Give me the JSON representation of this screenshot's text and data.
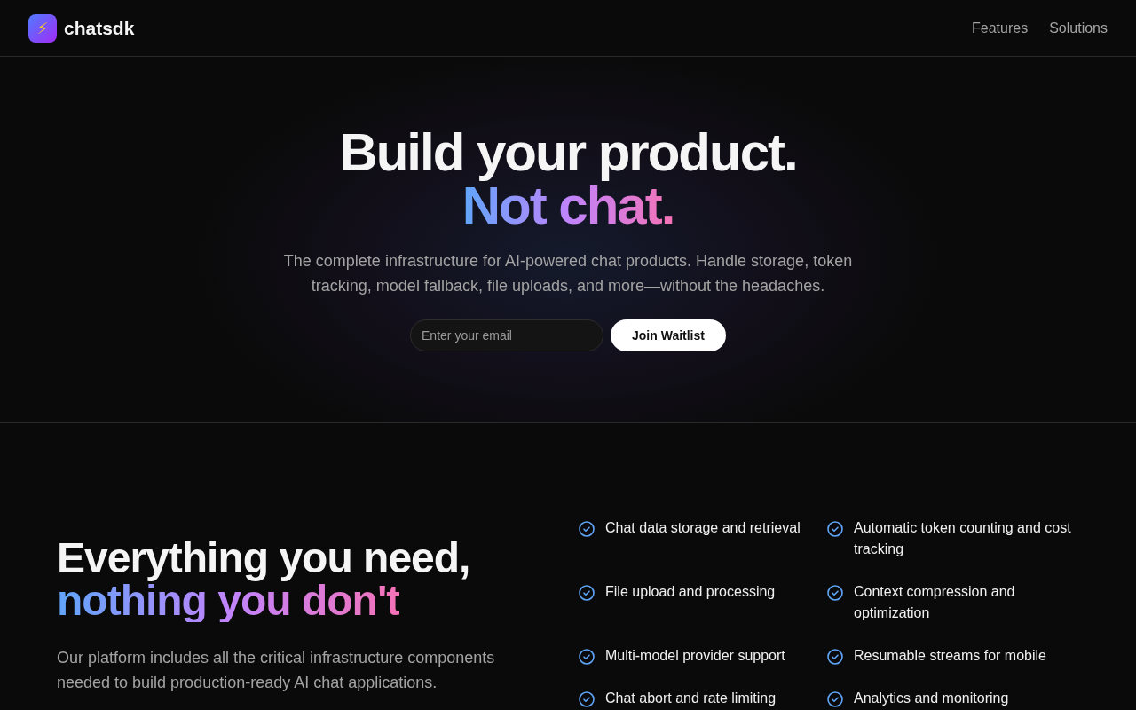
{
  "brand": {
    "logo": "⚡",
    "name": "chatsdk"
  },
  "nav": [
    {
      "label": "Features"
    },
    {
      "label": "Solutions"
    }
  ],
  "hero": {
    "title": "Build your product.",
    "accent": "Not chat.",
    "subtitle": "The complete infrastructure for AI-powered chat products. Handle storage, token tracking, model fallback, file uploads, and more—without the headaches.",
    "email": {
      "placeholder": "Enter your email"
    },
    "button": "Join Waitlist"
  },
  "features": {
    "title": "Everything you need,",
    "accent": "nothing you don't",
    "text": "Our platform includes all the critical infrastructure components needed to build production-ready AI chat applications.",
    "items": [
      {
        "label": "Chat data storage and retrieval"
      },
      {
        "label": "Automatic token counting and cost tracking"
      },
      {
        "label": "File upload and processing"
      },
      {
        "label": "Context compression and optimization"
      },
      {
        "label": "Multi-model provider support"
      },
      {
        "label": "Resumable streams for mobile"
      },
      {
        "label": "Chat abort and rate limiting"
      },
      {
        "label": "Analytics and monitoring"
      }
    ]
  }
}
